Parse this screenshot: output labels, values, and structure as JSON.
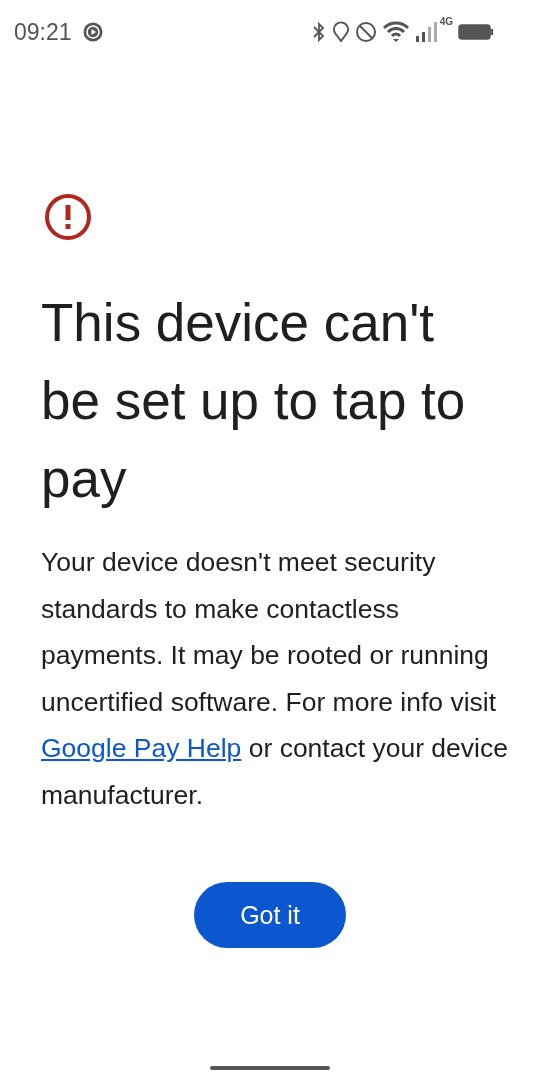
{
  "status_bar": {
    "time": "09:21",
    "network": "4G"
  },
  "title": "This device can't be set up to tap to pay",
  "message": {
    "before": "Your device doesn't meet security standards to make contactless payments. It may be rooted or running uncertified software. For more info visit ",
    "link": "Google Pay Help",
    "after": " or contact your device manufacturer."
  },
  "button": "Got it"
}
